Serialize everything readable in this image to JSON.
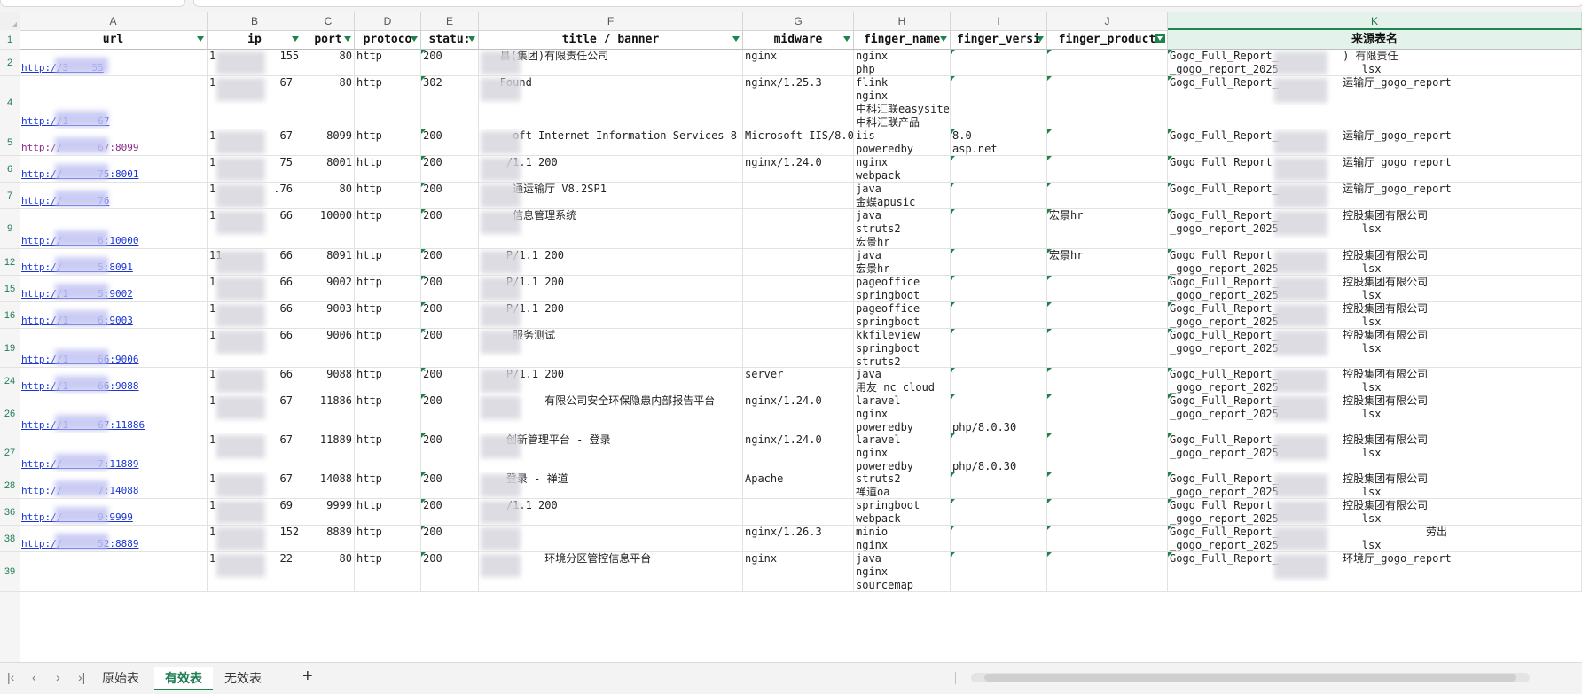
{
  "columns": [
    "A",
    "B",
    "C",
    "D",
    "E",
    "F",
    "G",
    "H",
    "I",
    "J",
    "K"
  ],
  "active_column": "K",
  "headers": [
    "url",
    "ip",
    "port",
    "protoco",
    "statu:",
    "title / banner",
    "midware",
    "finger_name",
    "finger_versi",
    "finger_product",
    "来源表名"
  ],
  "filtered_column_index": 9,
  "rows": [
    {
      "num": "2",
      "url": "http://3    55",
      "ip": "1          155",
      "port": "80",
      "proto": "http",
      "status": "200",
      "title": "   县(集团)有限责任公司",
      "midware": "nginx",
      "finger_name": "nginx\nphp",
      "finger_ver": "",
      "finger_prod": "",
      "source": "Gogo_Full_Report_          ) 有限责任\n_gogo_report_2025             lsx",
      "lines": 2
    },
    {
      "num": "4",
      "url": "http://1     67",
      "ip": "1          67",
      "port": "80",
      "proto": "http",
      "status": "302",
      "title": "   Found",
      "midware": "nginx/1.25.3",
      "finger_name": "flink\nnginx\n中科汇联easysite\n中科汇联产品",
      "finger_ver": "",
      "finger_prod": "",
      "source": "Gogo_Full_Report_          运输厅_gogo_report",
      "lines": 4
    },
    {
      "num": "5",
      "url": "http://      67:8099",
      "visited": true,
      "ip": "1          67",
      "port": "8099",
      "proto": "http",
      "status": "200",
      "title": "     oft Internet Information Services 8",
      "midware": "Microsoft-IIS/8.0",
      "finger_name": "iis\npoweredby",
      "finger_ver": "8.0\nasp.net",
      "finger_prod": "",
      "source": "Gogo_Full_Report_          运输厅_gogo_report",
      "lines": 2
    },
    {
      "num": "6",
      "url": "http://      75:8001",
      "ip": "1          75",
      "port": "8001",
      "proto": "http",
      "status": "200",
      "title": "    /1.1 200",
      "midware": "nginx/1.24.0",
      "finger_name": "nginx\nwebpack",
      "finger_ver": "",
      "finger_prod": "",
      "source": "Gogo_Full_Report_          运输厅_gogo_report",
      "lines": 2
    },
    {
      "num": "7",
      "url": "http://      76",
      "ip": "1         .76",
      "port": "80",
      "proto": "http",
      "status": "200",
      "title": "     通运输厅 V8.2SP1",
      "midware": "",
      "finger_name": "java\n金蝶apusic",
      "finger_ver": "",
      "finger_prod": "",
      "source": "Gogo_Full_Report_          运输厅_gogo_report",
      "lines": 2
    },
    {
      "num": "9",
      "url": "http://      6:10000",
      "ip": "1          66",
      "port": "10000",
      "proto": "http",
      "status": "200",
      "title": "     信息管理系统",
      "midware": "",
      "finger_name": "java\nstruts2\n宏景hr",
      "finger_ver": "",
      "finger_prod": "宏景hr",
      "source": "Gogo_Full_Report_          控股集团有限公司\n_gogo_report_2025             lsx",
      "lines": 3
    },
    {
      "num": "12",
      "url": "http://      5:8091",
      "ip": "11         66",
      "port": "8091",
      "proto": "http",
      "status": "200",
      "title": "    P/1.1 200",
      "midware": "",
      "finger_name": "java\n宏景hr",
      "finger_ver": "",
      "finger_prod": "宏景hr",
      "source": "Gogo_Full_Report_          控股集团有限公司\n_gogo_report_2025             lsx",
      "lines": 2
    },
    {
      "num": "15",
      "url": "http://1     5:9002",
      "ip": "1          66",
      "port": "9002",
      "proto": "http",
      "status": "200",
      "title": "    P/1.1 200",
      "midware": "",
      "finger_name": "pageoffice\nspringboot",
      "finger_ver": "",
      "finger_prod": "",
      "source": "Gogo_Full_Report_          控股集团有限公司\n_gogo_report_2025             lsx",
      "lines": 2
    },
    {
      "num": "16",
      "url": "http://1     6:9003",
      "ip": "1          66",
      "port": "9003",
      "proto": "http",
      "status": "200",
      "title": "    P/1.1 200",
      "midware": "",
      "finger_name": "pageoffice\nspringboot",
      "finger_ver": "",
      "finger_prod": "",
      "source": "Gogo_Full_Report_          控股集团有限公司\n_gogo_report_2025             lsx",
      "lines": 2
    },
    {
      "num": "19",
      "url": "http://1     66:9006",
      "ip": "1          66",
      "port": "9006",
      "proto": "http",
      "status": "200",
      "title": "     服务测试",
      "midware": "",
      "finger_name": "kkfileview\nspringboot\nstruts2",
      "finger_ver": "",
      "finger_prod": "",
      "source": "Gogo_Full_Report_          控股集团有限公司\n_gogo_report_2025             lsx",
      "lines": 3
    },
    {
      "num": "24",
      "url": "http://1     66:9088",
      "ip": "1          66",
      "port": "9088",
      "proto": "http",
      "status": "200",
      "title": "    P/1.1 200",
      "midware": "server",
      "finger_name": "java\n用友 nc cloud",
      "finger_ver": "",
      "finger_prod": "",
      "source": "Gogo_Full_Report_          控股集团有限公司\n_gogo_report_2025             lsx",
      "lines": 2
    },
    {
      "num": "26",
      "url": "http://1     67:11886",
      "ip": "1          67",
      "port": "11886",
      "proto": "http",
      "status": "200",
      "title": "          有限公司安全环保隐患内部报告平台",
      "midware": "nginx/1.24.0",
      "finger_name": "laravel\nnginx\npoweredby",
      "finger_ver": "\n\nphp/8.0.30",
      "finger_prod": "",
      "source": "Gogo_Full_Report_          控股集团有限公司\n_gogo_report_2025             lsx",
      "lines": 3
    },
    {
      "num": "27",
      "url": "http://      7:11889",
      "ip": "1          67",
      "port": "11889",
      "proto": "http",
      "status": "200",
      "title": "    创新管理平台 - 登录",
      "midware": "nginx/1.24.0",
      "finger_name": "laravel\nnginx\npoweredby",
      "finger_ver": "\n\nphp/8.0.30",
      "finger_prod": "",
      "source": "Gogo_Full_Report_          控股集团有限公司\n_gogo_report_2025             lsx",
      "lines": 3
    },
    {
      "num": "28",
      "url": "http://      7:14088",
      "ip": "1          67",
      "port": "14088",
      "proto": "http",
      "status": "200",
      "title": "    登录 - 禅道",
      "midware": "Apache",
      "finger_name": "struts2\n禅道oa",
      "finger_ver": "",
      "finger_prod": "",
      "source": "Gogo_Full_Report_          控股集团有限公司\n_gogo_report_2025             lsx",
      "lines": 2
    },
    {
      "num": "36",
      "url": "http://      9:9999",
      "ip": "1          69",
      "port": "9999",
      "proto": "http",
      "status": "200",
      "title": "    /1.1 200",
      "midware": "",
      "finger_name": "springboot\nwebpack",
      "finger_ver": "",
      "finger_prod": "",
      "source": "Gogo_Full_Report_          控股集团有限公司\n_gogo_report_2025             lsx",
      "lines": 2
    },
    {
      "num": "38",
      "url": "http://      52:8889",
      "ip": "1          152",
      "port": "8889",
      "proto": "http",
      "status": "200",
      "title": "",
      "midware": "nginx/1.26.3",
      "finger_name": "minio\nnginx",
      "finger_ver": "",
      "finger_prod": "",
      "source": "Gogo_Full_Report_                       劳出\n_gogo_report_2025             lsx",
      "lines": 2
    },
    {
      "num": "39",
      "url": "",
      "ip": "1          22",
      "port": "80",
      "proto": "http",
      "status": "200",
      "title": "          环境分区管控信息平台",
      "midware": "nginx",
      "finger_name": "java\nnginx\nsourcemap",
      "finger_ver": "",
      "finger_prod": "",
      "source": "Gogo_Full_Report_          环境厅_gogo_report",
      "lines": 3
    }
  ],
  "sheets": [
    {
      "label": "原始表",
      "active": false
    },
    {
      "label": "有效表",
      "active": true
    },
    {
      "label": "无效表",
      "active": false
    }
  ],
  "icons": [
    "first-sheet-icon",
    "prev-sheet-icon",
    "next-sheet-icon",
    "last-sheet-icon",
    "add-sheet-icon",
    "filter-dropdown-icon",
    "filter-active-icon"
  ],
  "colors": {
    "accent": "#1e8449",
    "link": "#1a35d4",
    "visited_link": "#8b2a8b"
  }
}
